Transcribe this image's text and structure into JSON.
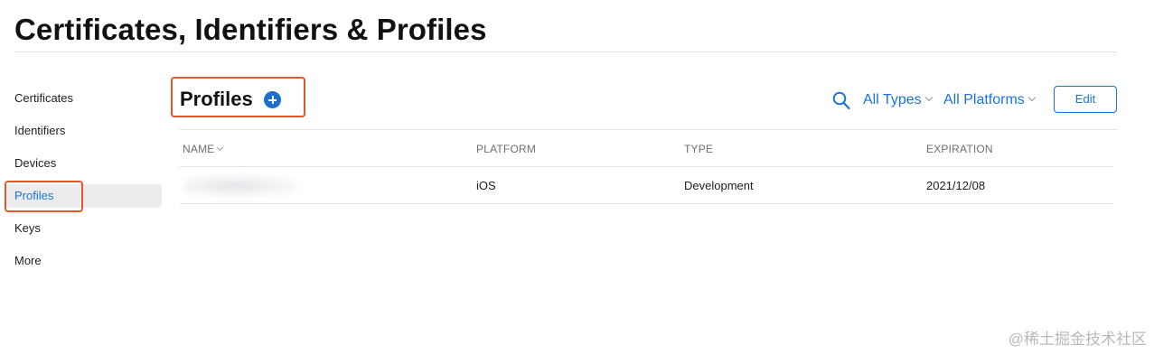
{
  "page": {
    "title": "Certificates, Identifiers & Profiles"
  },
  "sidebar": {
    "items": [
      {
        "label": "Certificates",
        "active": false
      },
      {
        "label": "Identifiers",
        "active": false
      },
      {
        "label": "Devices",
        "active": false
      },
      {
        "label": "Profiles",
        "active": true
      },
      {
        "label": "Keys",
        "active": false
      },
      {
        "label": "More",
        "active": false
      }
    ]
  },
  "section": {
    "title": "Profiles",
    "add_icon": "plus-circle-icon"
  },
  "toolbar": {
    "search_icon": "search-icon",
    "type_filter": "All Types",
    "platform_filter": "All Platforms",
    "edit_label": "Edit"
  },
  "table": {
    "columns": [
      "NAME",
      "PLATFORM",
      "TYPE",
      "EXPIRATION"
    ],
    "rows": [
      {
        "name": "",
        "platform": "iOS",
        "type": "Development",
        "expiration": "2021/12/08"
      }
    ]
  },
  "watermark": "@稀土掘金技术社区",
  "colors": {
    "accent": "#1a73d9",
    "highlight": "#e3572a",
    "active_bg": "#ececef"
  }
}
